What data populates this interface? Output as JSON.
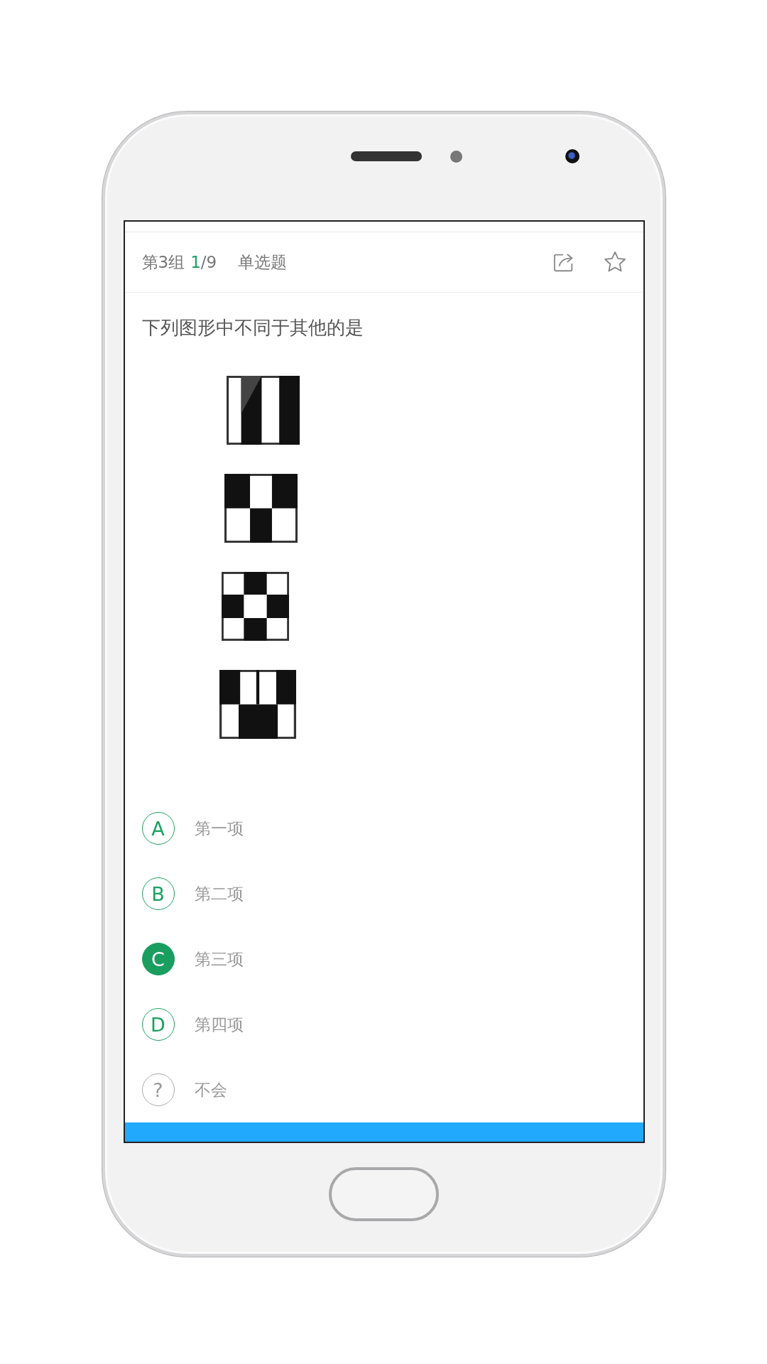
{
  "header": {
    "group": "第3组",
    "current": "1",
    "rest": "/9",
    "type": "单选题"
  },
  "question": "下列图形中不同于其他的是",
  "options": [
    {
      "kind": "choice",
      "letter": "A",
      "text": "第一项",
      "selected": false
    },
    {
      "kind": "choice",
      "letter": "B",
      "text": "第二项",
      "selected": false
    },
    {
      "kind": "choice",
      "letter": "C",
      "text": "第三项",
      "selected": true
    },
    {
      "kind": "choice",
      "letter": "D",
      "text": "第四项",
      "selected": false
    },
    {
      "kind": "skip",
      "letter": "?",
      "text": "不会",
      "selected": false
    }
  ]
}
